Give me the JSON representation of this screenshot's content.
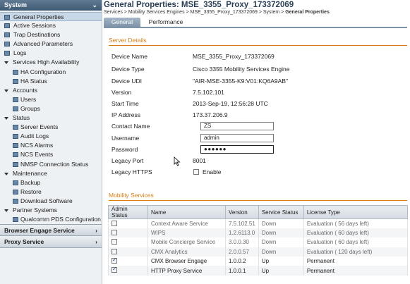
{
  "sidebar": {
    "header": "System",
    "items": [
      {
        "label": "General Properties",
        "level": 1,
        "selected": true
      },
      {
        "label": "Active Sessions",
        "level": 1
      },
      {
        "label": "Trap Destinations",
        "level": 1
      },
      {
        "label": "Advanced Parameters",
        "level": 1
      },
      {
        "label": "Logs",
        "level": 1
      },
      {
        "label": "Services High Availability",
        "level": 0
      },
      {
        "label": "HA Configuration",
        "level": 2
      },
      {
        "label": "HA Status",
        "level": 2
      },
      {
        "label": "Accounts",
        "level": 0
      },
      {
        "label": "Users",
        "level": 2
      },
      {
        "label": "Groups",
        "level": 2
      },
      {
        "label": "Status",
        "level": 0
      },
      {
        "label": "Server Events",
        "level": 2
      },
      {
        "label": "Audit Logs",
        "level": 2
      },
      {
        "label": "NCS Alarms",
        "level": 2
      },
      {
        "label": "NCS Events",
        "level": 2
      },
      {
        "label": "NMSP Connection Status",
        "level": 2
      },
      {
        "label": "Maintenance",
        "level": 0
      },
      {
        "label": "Backup",
        "level": 2
      },
      {
        "label": "Restore",
        "level": 2
      },
      {
        "label": "Download Software",
        "level": 2
      },
      {
        "label": "Partner Systems",
        "level": 0
      },
      {
        "label": "Qualcomm PDS Configuration",
        "level": 2
      }
    ],
    "bottom": [
      {
        "label": "Browser Engage Service"
      },
      {
        "label": "Proxy Service"
      }
    ]
  },
  "page": {
    "title": "General Properties: MSE_3355_Proxy_173372069",
    "breadcrumb": "Services > Mobility Services Engines > MSE_3355_Proxy_173372069 > System > ",
    "breadcrumb_current": "General Properties",
    "tabs": [
      "General",
      "Performance"
    ]
  },
  "server_details": {
    "title": "Server Details",
    "rows": [
      {
        "label": "Device Name",
        "value": "MSE_3355_Proxy_173372069"
      },
      {
        "label": "Device Type",
        "value": "Cisco 3355 Mobility Services Engine"
      },
      {
        "label": "Device UDI",
        "value": "\"AIR-MSE-3355-K9:V01:KQ6A9AB\""
      },
      {
        "label": "Version",
        "value": "7.5.102.101"
      },
      {
        "label": "Start Time",
        "value": "2013-Sep-19, 12:56:28 UTC"
      },
      {
        "label": "IP Address",
        "value": "173.37.206.9"
      }
    ],
    "contact_name": {
      "label": "Contact Name",
      "value": "ZS"
    },
    "username": {
      "label": "Username",
      "value": "admin"
    },
    "password": {
      "label": "Password",
      "value": "●●●●●●"
    },
    "legacy_port": {
      "label": "Legacy Port",
      "value": "8001"
    },
    "legacy_https": {
      "label": "Legacy HTTPS",
      "checkbox_label": "Enable"
    }
  },
  "mobility_services": {
    "title": "Mobility Services",
    "columns": [
      "Admin Status",
      "Name",
      "Version",
      "Service Status",
      "License Type"
    ],
    "rows": [
      {
        "checked": false,
        "name": "Context Aware Service",
        "version": "7.5.102.51",
        "status": "Down",
        "license": "Evaluation ( 56 days left)"
      },
      {
        "checked": false,
        "name": "WIPS",
        "version": "1.2.6113.0",
        "status": "Down",
        "license": "Evaluation ( 60 days left)"
      },
      {
        "checked": false,
        "name": "Mobile Concierge Service",
        "version": "3.0.0.30",
        "status": "Down",
        "license": "Evaluation ( 60 days left)"
      },
      {
        "checked": false,
        "name": "CMX Analytics",
        "version": "2.0.0.57",
        "status": "Down",
        "license": "Evaluation ( 120 days left)"
      },
      {
        "checked": true,
        "name": "CMX Browser Engage",
        "version": "1.0.0.2",
        "status": "Up",
        "license": "Permanent"
      },
      {
        "checked": true,
        "name": "HTTP Proxy Service",
        "version": "1.0.0.1",
        "status": "Up",
        "license": "Permanent"
      }
    ]
  }
}
